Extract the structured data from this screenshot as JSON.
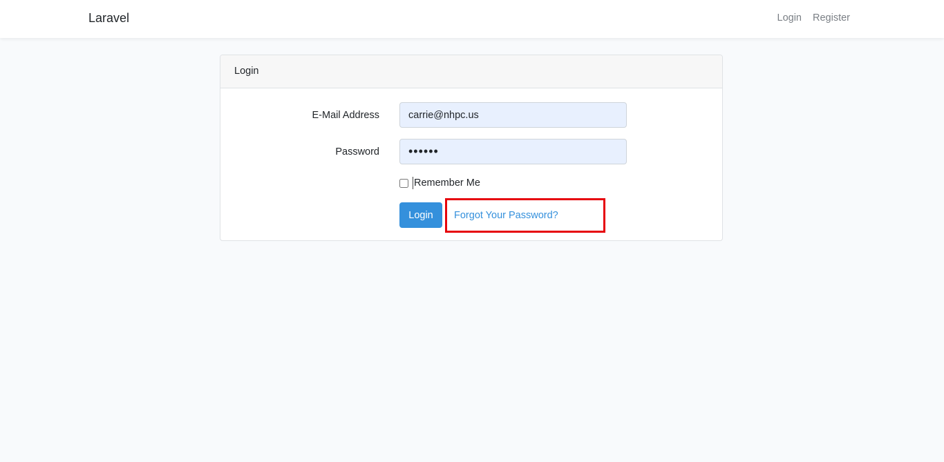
{
  "navbar": {
    "brand": "Laravel",
    "links": [
      "Login",
      "Register"
    ]
  },
  "card": {
    "header": "Login",
    "email": {
      "label": "E-Mail Address",
      "value": "carrie@nhpc.us"
    },
    "password": {
      "label": "Password",
      "value": "••••••"
    },
    "remember": {
      "label": "Remember Me",
      "checked": false
    },
    "submit_label": "Login",
    "forgot_label": "Forgot Your Password?"
  },
  "colors": {
    "primary": "#3490dc",
    "highlight": "#e6000a",
    "input_autofill": "#e8f0fe",
    "page_bg": "#f8fafc"
  }
}
